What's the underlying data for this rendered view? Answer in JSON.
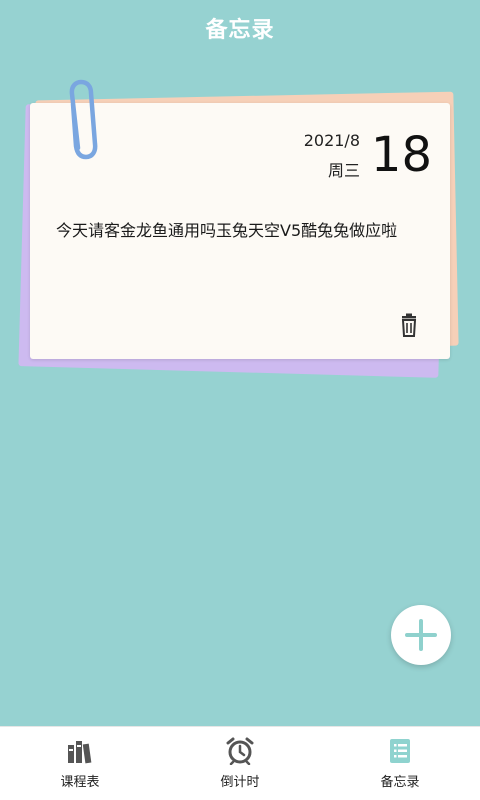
{
  "header": {
    "title": "备忘录"
  },
  "memo": {
    "date_year_month": "2021/8",
    "weekday": "周三",
    "day": "18",
    "content": "今天请客金龙鱼通用吗玉兔天空V5酷兔兔做应啦"
  },
  "icons": {
    "paperclip": "paperclip-icon",
    "trash": "trash-icon",
    "add": "plus-icon"
  },
  "bottom_nav": {
    "items": [
      {
        "label": "课程表",
        "icon": "books-icon",
        "active": false
      },
      {
        "label": "倒计时",
        "icon": "alarm-clock-icon",
        "active": false
      },
      {
        "label": "备忘录",
        "icon": "memo-list-icon",
        "active": true
      }
    ]
  },
  "colors": {
    "background": "#96d2d1",
    "accent": "#8fd1cd",
    "paperclip": "#7aa6e0",
    "active_icon": "#8fd3cf",
    "inactive_icon": "#555555"
  }
}
